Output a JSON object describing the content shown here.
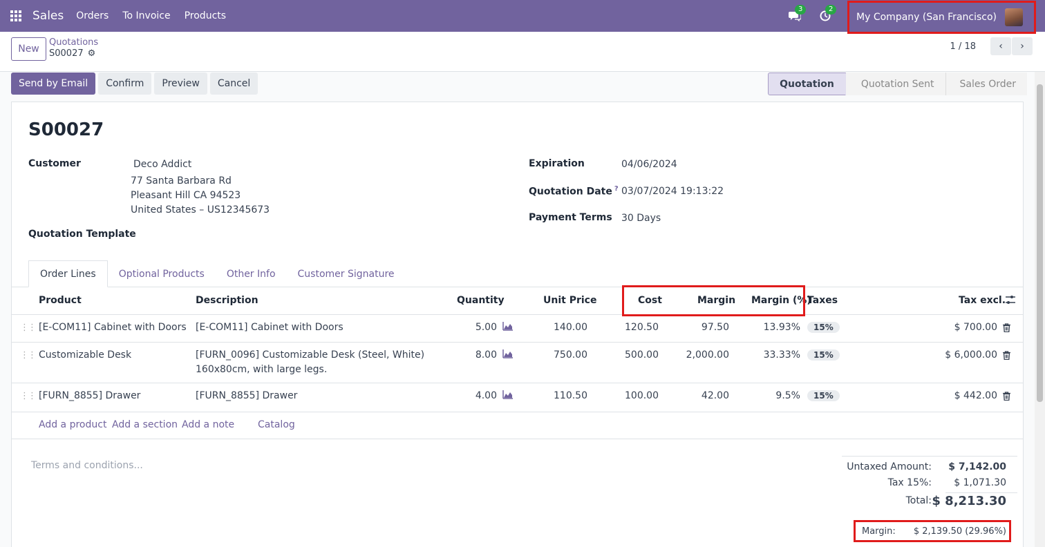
{
  "navbar": {
    "app_name": "Sales",
    "menu": [
      "Orders",
      "To Invoice",
      "Products"
    ],
    "messages_count": "3",
    "activities_count": "2",
    "company": "My Company (San Francisco)"
  },
  "control_panel": {
    "new_label": "New",
    "breadcrumb_parent": "Quotations",
    "breadcrumb_current": "S00027",
    "pager": "1 / 18"
  },
  "actions": {
    "send_by_email": "Send by Email",
    "confirm": "Confirm",
    "preview": "Preview",
    "cancel": "Cancel"
  },
  "stages": [
    "Quotation",
    "Quotation Sent",
    "Sales Order"
  ],
  "form": {
    "title": "S00027",
    "customer_label": "Customer",
    "customer_name": "Deco Addict",
    "customer_address1": "77 Santa Barbara Rd",
    "customer_address2": "Pleasant Hill CA 94523",
    "customer_address3": "United States – US12345673",
    "template_label": "Quotation Template",
    "expiration_label": "Expiration",
    "expiration_value": "04/06/2024",
    "quotation_date_label": "Quotation Date",
    "quotation_date_help": "?",
    "quotation_date_value": "03/07/2024 19:13:22",
    "payment_terms_label": "Payment Terms",
    "payment_terms_value": "30 Days"
  },
  "tabs": [
    "Order Lines",
    "Optional Products",
    "Other Info",
    "Customer Signature"
  ],
  "table": {
    "headers": {
      "product": "Product",
      "description": "Description",
      "quantity": "Quantity",
      "unit_price": "Unit Price",
      "cost": "Cost",
      "margin": "Margin",
      "margin_pct": "Margin (%)",
      "taxes": "Taxes",
      "tax_excl": "Tax excl."
    },
    "rows": [
      {
        "product": "[E-COM11] Cabinet with Doors",
        "description": "[E-COM11] Cabinet with Doors",
        "description2": "",
        "quantity": "5.00",
        "unit_price": "140.00",
        "cost": "120.50",
        "margin": "97.50",
        "margin_pct": "13.93%",
        "tax": "15%",
        "subtotal": "$ 700.00"
      },
      {
        "product": "Customizable Desk",
        "description": "[FURN_0096] Customizable Desk (Steel, White)",
        "description2": "160x80cm, with large legs.",
        "quantity": "8.00",
        "unit_price": "750.00",
        "cost": "500.00",
        "margin": "2,000.00",
        "margin_pct": "33.33%",
        "tax": "15%",
        "subtotal": "$ 6,000.00"
      },
      {
        "product": "[FURN_8855] Drawer",
        "description": "[FURN_8855] Drawer",
        "description2": "",
        "quantity": "4.00",
        "unit_price": "110.50",
        "cost": "100.00",
        "margin": "42.00",
        "margin_pct": "9.5%",
        "tax": "15%",
        "subtotal": "$ 442.00"
      }
    ],
    "add_product": "Add a product",
    "add_section": "Add a section",
    "add_note": "Add a note",
    "catalog": "Catalog"
  },
  "terms_placeholder": "Terms and conditions...",
  "totals": {
    "untaxed_label": "Untaxed Amount:",
    "untaxed_value": "$ 7,142.00",
    "tax_label": "Tax 15%:",
    "tax_value": "$ 1,071.30",
    "total_label": "Total:",
    "total_value": "$ 8,213.30",
    "margin_label": "Margin:",
    "margin_value": "$ 2,139.50 (29.96%)"
  },
  "colors": {
    "brand": "#71639e",
    "highlight": "#e01b1b",
    "badge_green": "#28a745"
  }
}
